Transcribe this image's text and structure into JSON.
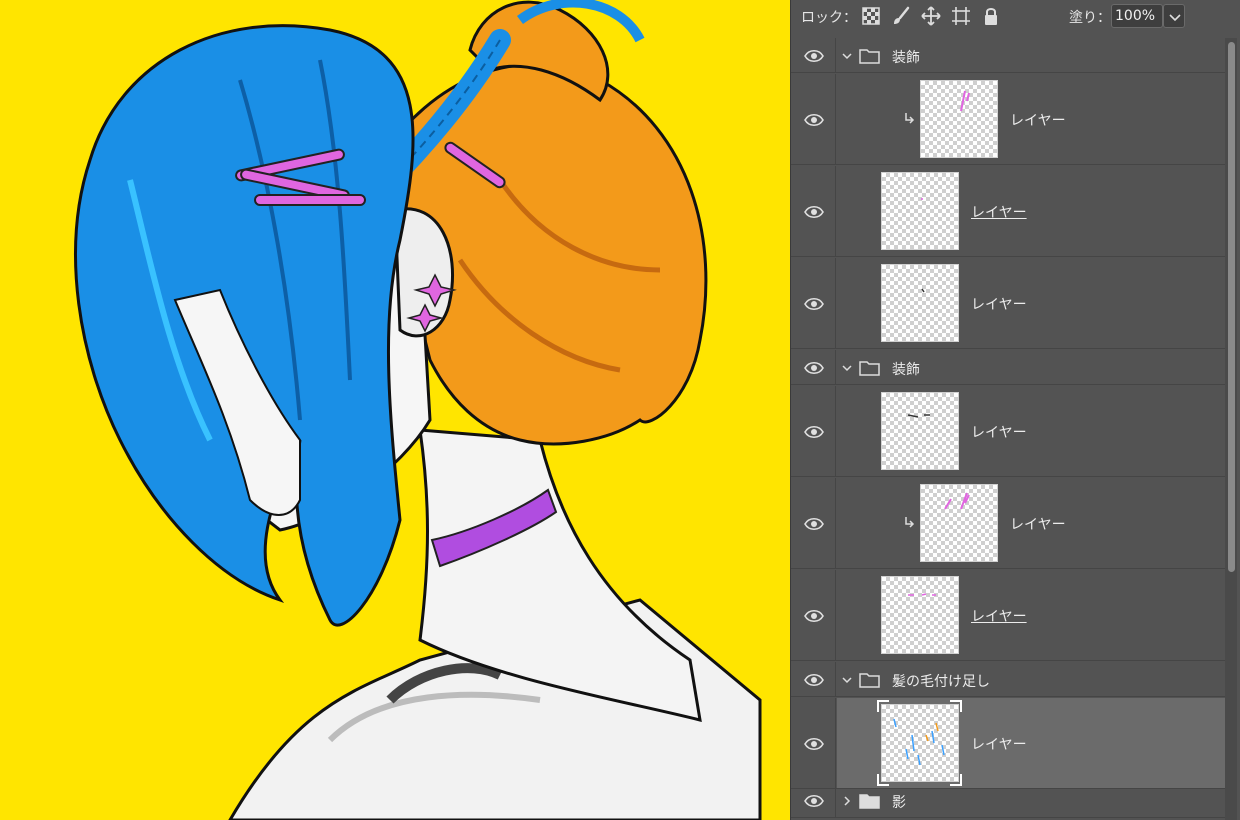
{
  "toolbar": {
    "lock_label": "ロック：",
    "lock_icons": [
      "lock-transparent-pixels-icon",
      "lock-image-pixels-icon",
      "lock-position-icon",
      "lock-artboard-icon",
      "lock-all-icon"
    ],
    "fill_label": "塗り：",
    "fill_value": "100%"
  },
  "layers": [
    {
      "type": "group",
      "name": "装飾",
      "expanded": true
    },
    {
      "type": "layer",
      "name": "レイヤー",
      "clipped": true,
      "underlined": false,
      "thumb": "pink-sparkle"
    },
    {
      "type": "layer",
      "name": "レイヤー",
      "clipped": false,
      "underlined": true,
      "thumb": "tiny-dot"
    },
    {
      "type": "layer",
      "name": "レイヤー",
      "clipped": false,
      "underlined": false,
      "thumb": "tiny-dark"
    },
    {
      "type": "group",
      "name": "装飾",
      "expanded": true
    },
    {
      "type": "layer",
      "name": "レイヤー",
      "clipped": false,
      "underlined": false,
      "thumb": "dark-dots"
    },
    {
      "type": "layer",
      "name": "レイヤー",
      "clipped": true,
      "underlined": false,
      "thumb": "pink-strokes"
    },
    {
      "type": "layer",
      "name": "レイヤー",
      "clipped": false,
      "underlined": true,
      "thumb": "pink-dots"
    },
    {
      "type": "group",
      "name": "髪の毛付け足し",
      "expanded": true
    },
    {
      "type": "layer",
      "name": "レイヤー",
      "clipped": false,
      "underlined": false,
      "selected": true,
      "thumb": "hair-strands"
    },
    {
      "type": "group",
      "name": "影",
      "expanded": false
    }
  ],
  "colors": {
    "canvas_bg": "#ffe500",
    "panel_bg": "#535353",
    "selected_row": "#6b6b6b",
    "hair_blue": "#1a8fe6",
    "hair_orange": "#f39a1a",
    "choker": "#b04de0",
    "accent_pink": "#e066e0"
  }
}
